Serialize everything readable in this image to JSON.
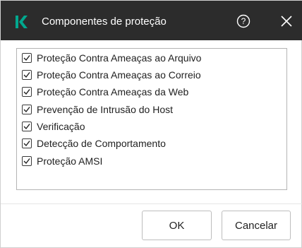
{
  "dialog": {
    "title": "Componentes de proteção",
    "header_color": "#2c2c2c",
    "brand_color": "#00a88e",
    "logo_icon": "kaspersky-logo",
    "help_icon": "help-circle-icon",
    "close_icon": "close-icon"
  },
  "components": [
    {
      "label": "Proteção Contra Ameaças ao Arquivo",
      "checked": true
    },
    {
      "label": "Proteção Contra Ameaças ao Correio",
      "checked": true
    },
    {
      "label": "Proteção Contra Ameaças da Web",
      "checked": true
    },
    {
      "label": "Prevenção de Intrusão do Host",
      "checked": true
    },
    {
      "label": "Verificação",
      "checked": true
    },
    {
      "label": "Detecção de Comportamento",
      "checked": true
    },
    {
      "label": "Proteção AMSI",
      "checked": true
    }
  ],
  "buttons": {
    "ok_label": "OK",
    "cancel_label": "Cancelar"
  }
}
